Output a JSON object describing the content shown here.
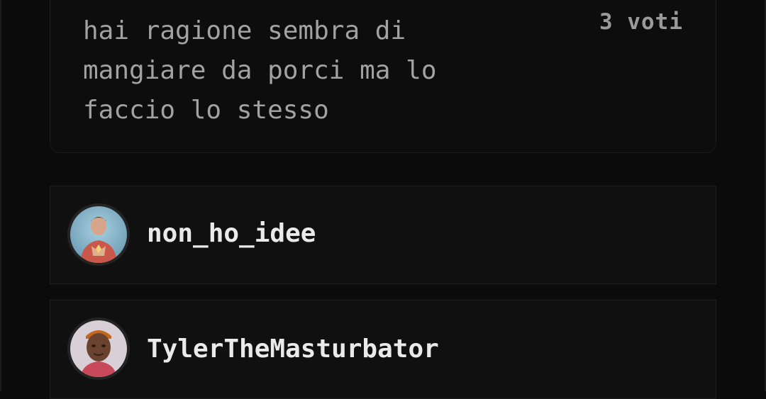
{
  "comment": {
    "text": "hai ragione sembra di mangiare da porci ma lo faccio lo stesso",
    "votes": "3 voti"
  },
  "users": [
    {
      "username": "non_ho_idee",
      "avatar_icon": "user-avatar-icon"
    },
    {
      "username": "TylerTheMasturbator",
      "avatar_icon": "user-avatar-icon"
    }
  ],
  "colors": {
    "background": "#0b0b0b",
    "card": "#0d0d0d",
    "row": "#101010",
    "text_muted": "#a2a2a2",
    "text_primary": "#eaeaea"
  }
}
